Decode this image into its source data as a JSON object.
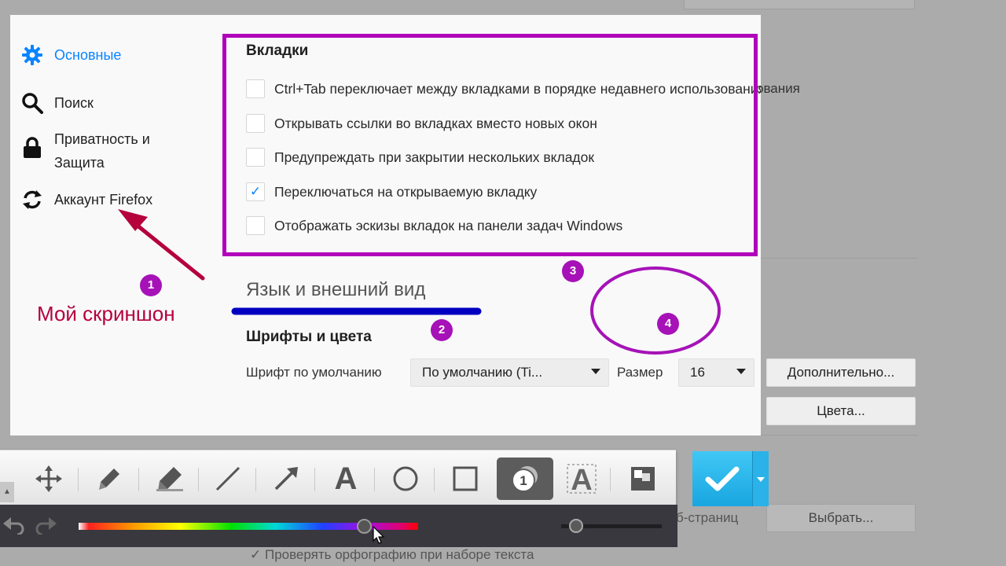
{
  "background": {
    "pages_partial": "б-страниц",
    "choose_button": "Выбрать...",
    "spellcheck_label": "Проверять орфографию при наборе текста"
  },
  "sidebar": {
    "items": [
      {
        "label": "Основные",
        "icon": "gear-icon"
      },
      {
        "label": "Поиск",
        "icon": "search-icon"
      },
      {
        "label": "Приватность и Защита",
        "icon": "lock-icon"
      },
      {
        "label": "Аккаунт Firefox",
        "icon": "sync-icon"
      }
    ],
    "accent": "#0a84ff"
  },
  "tabs": {
    "title": "Вкладки",
    "options": [
      {
        "label": "Ctrl+Tab переключает между вкладками в порядке недавнего использования",
        "checked": false
      },
      {
        "label": "Открывать ссылки во вкладках вместо новых окон",
        "checked": false
      },
      {
        "label": "Предупреждать при закрытии нескольких вкладок",
        "checked": false
      },
      {
        "label": "Переключаться на открываемую вкладку",
        "checked": true
      },
      {
        "label": "Отображать эскизы вкладок на панели задач Windows",
        "checked": false
      }
    ]
  },
  "language": {
    "title": "Язык и внешний вид",
    "fonts_title": "Шрифты и цвета",
    "default_font_label": "Шрифт по умолчанию",
    "default_font_value": "По умолчанию (Ti...",
    "size_label": "Размер",
    "size_value": "16",
    "advanced_button": "Дополнительно...",
    "colors_button": "Цвета..."
  },
  "annotations": {
    "caption": "Мой скриншон",
    "badges": [
      "1",
      "2",
      "3",
      "4"
    ],
    "frame_color": "#b100b9",
    "arrow_color": "#b5003c",
    "underline_color": "#0000c0"
  },
  "toolbar": {
    "tools": [
      "move-icon",
      "pencil-icon",
      "marker-icon",
      "line-icon",
      "arrow-icon",
      "text-icon",
      "ellipse-icon",
      "rectangle-icon",
      "step-number-icon",
      "outline-text-icon",
      "blur-icon"
    ],
    "active_tool": "step-number-icon",
    "step_number": "1",
    "text_tool_glyph": "A"
  }
}
